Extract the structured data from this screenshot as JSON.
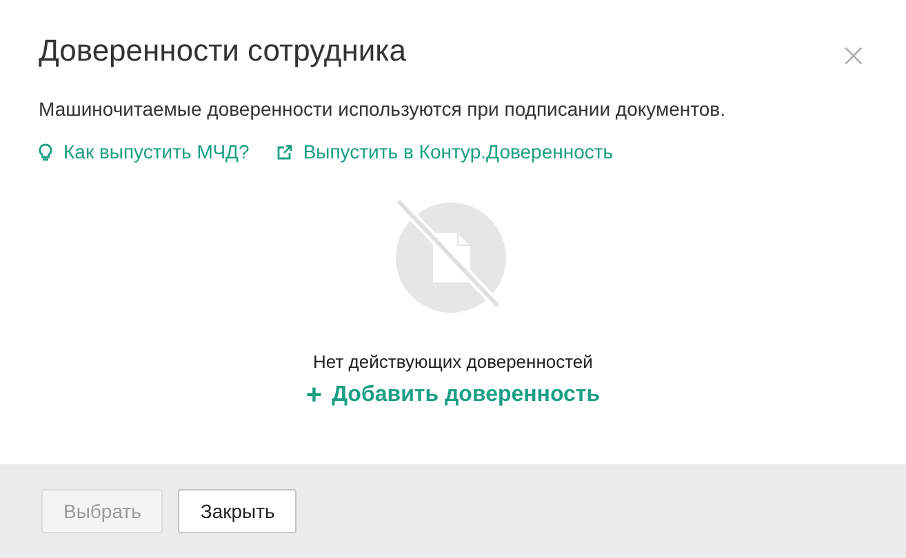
{
  "dialog": {
    "title": "Доверенности сотрудника",
    "close": "×"
  },
  "description": "Машиночитаемые доверенности используются при подписании документов.",
  "links": [
    {
      "kind": "hint",
      "label": "Как выпустить МЧД?"
    },
    {
      "kind": "external",
      "label": "Выпустить в Контур.Доверенность"
    }
  ],
  "empty_state": {
    "message": "Нет действующих доверенностей",
    "action_icon": "+",
    "action": "Добавить доверенность"
  },
  "buttons": [
    {
      "label": "Выбрать",
      "disabled": true
    },
    {
      "label": "Закрыть",
      "disabled": false
    }
  ]
}
